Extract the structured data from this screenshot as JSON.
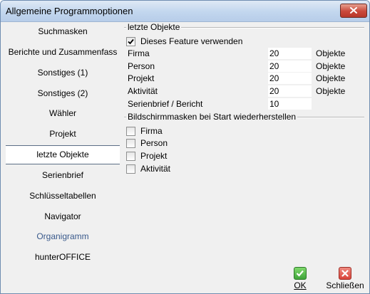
{
  "window": {
    "title": "Allgemeine Programmoptionen"
  },
  "sidebar": {
    "items": [
      {
        "label": "Suchmasken"
      },
      {
        "label": "Berichte und Zusammenfass"
      },
      {
        "label": "Sonstiges (1)"
      },
      {
        "label": "Sonstiges (2)"
      },
      {
        "label": "Wähler"
      },
      {
        "label": "Projekt"
      },
      {
        "label": "letzte Objekte",
        "selected": true
      },
      {
        "label": "Serienbrief"
      },
      {
        "label": "Schlüsseltabellen"
      },
      {
        "label": "Navigator"
      },
      {
        "label": "Organigramm"
      },
      {
        "label": "hunterOFFICE"
      }
    ]
  },
  "recent": {
    "section_title": "letzte Objekte",
    "use_feature": {
      "label": "Dieses Feature verwenden",
      "checked": true
    },
    "fields": [
      {
        "label": "Firma",
        "value": "20",
        "unit": "Objekte"
      },
      {
        "label": "Person",
        "value": "20",
        "unit": "Objekte"
      },
      {
        "label": "Projekt",
        "value": "20",
        "unit": "Objekte"
      },
      {
        "label": "Aktivität",
        "value": "20",
        "unit": "Objekte"
      },
      {
        "label": "Serienbrief / Bericht",
        "value": "10",
        "unit": ""
      }
    ]
  },
  "restore": {
    "section_title": "Bildschirmmasken bei Start wiederherstellen",
    "options": [
      {
        "label": "Firma",
        "checked": false
      },
      {
        "label": "Person",
        "checked": false
      },
      {
        "label": "Projekt",
        "checked": false
      },
      {
        "label": "Aktivität",
        "checked": false
      }
    ]
  },
  "footer": {
    "ok_label": "OK",
    "close_label": "Schließen"
  },
  "colors": {
    "ok_green": "#3fa43a",
    "close_red": "#d9443a",
    "link_blue": "#3a5a8c",
    "title_bar": "#c2d6ee"
  }
}
